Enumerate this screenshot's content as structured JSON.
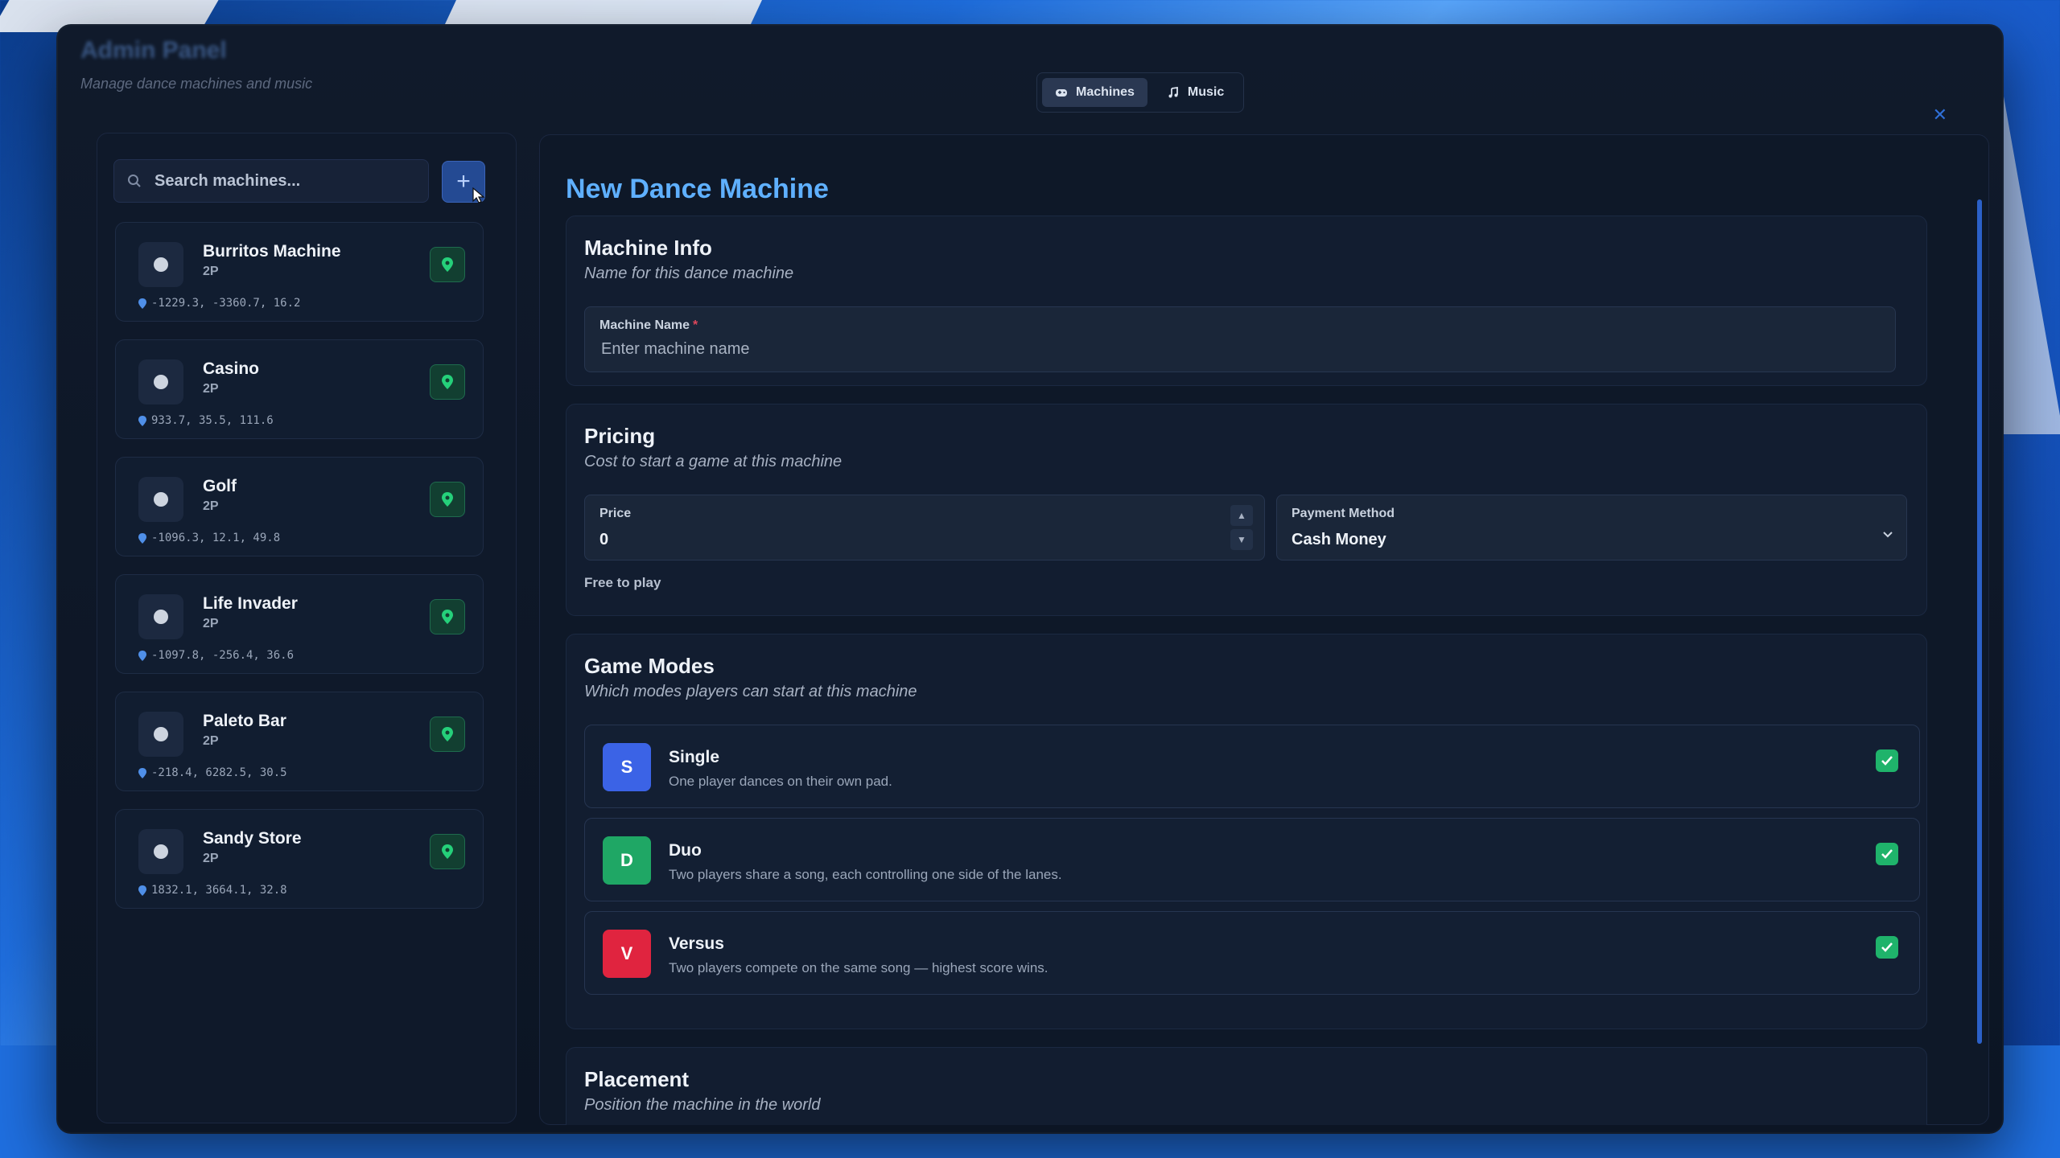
{
  "header": {
    "title": "Admin Panel",
    "subtitle": "Manage dance machines and music"
  },
  "tabs": [
    {
      "label": "Machines",
      "icon": "gamepad-icon",
      "active": true
    },
    {
      "label": "Music",
      "icon": "music-note-icon",
      "active": false
    }
  ],
  "sidebar": {
    "search_placeholder": "Search machines...",
    "machines": [
      {
        "name": "Burritos Machine",
        "players": "2P",
        "coords": "-1229.3, -3360.7, 16.2"
      },
      {
        "name": "Casino",
        "players": "2P",
        "coords": "933.7, 35.5, 111.6"
      },
      {
        "name": "Golf",
        "players": "2P",
        "coords": "-1096.3, 12.1, 49.8"
      },
      {
        "name": "Life Invader",
        "players": "2P",
        "coords": "-1097.8, -256.4, 36.6"
      },
      {
        "name": "Paleto Bar",
        "players": "2P",
        "coords": "-218.4, 6282.5, 30.5"
      },
      {
        "name": "Sandy Store",
        "players": "2P",
        "coords": "1832.1, 3664.1, 32.8"
      }
    ]
  },
  "main": {
    "title": "New Dance Machine",
    "machine_info": {
      "title": "Machine Info",
      "subtitle": "Name for this dance machine",
      "name_label": "Machine Name",
      "required_mark": "*",
      "name_placeholder": "Enter machine name",
      "name_value": ""
    },
    "pricing": {
      "title": "Pricing",
      "subtitle": "Cost to start a game at this machine",
      "price_label": "Price",
      "price_value": "0",
      "payment_label": "Payment Method",
      "payment_value": "Cash Money",
      "note": "Free to play"
    },
    "game_modes": {
      "title": "Game Modes",
      "subtitle": "Which modes players can start at this machine",
      "modes": [
        {
          "letter": "S",
          "name": "Single",
          "desc": "One player dances on their own pad.",
          "color": "#3b63e6",
          "enabled": true
        },
        {
          "letter": "D",
          "name": "Duo",
          "desc": "Two players share a song, each controlling one side of the lanes.",
          "color": "#1fa765",
          "enabled": true
        },
        {
          "letter": "V",
          "name": "Versus",
          "desc": "Two players compete on the same song — highest score wins.",
          "color": "#e0243f",
          "enabled": true
        }
      ]
    },
    "placement": {
      "title": "Placement",
      "subtitle": "Position the machine in the world"
    }
  },
  "colors": {
    "accent": "#5fb0ff",
    "location_green": "#25d07a",
    "check_green": "#1fb36b"
  }
}
